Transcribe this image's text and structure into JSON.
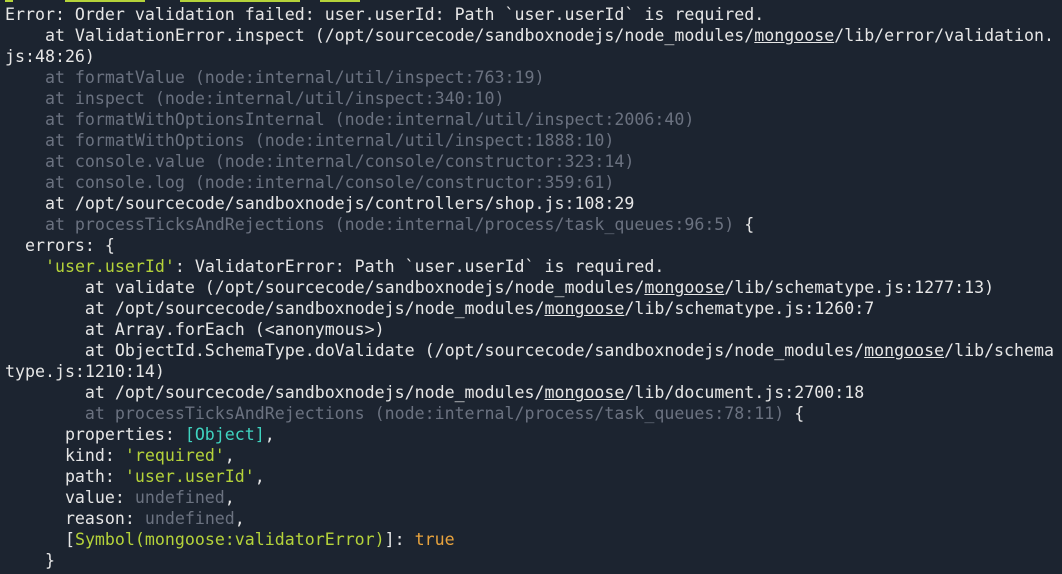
{
  "terminal": {
    "colors": {
      "background": "#1c2430",
      "text": "#e6e6e6",
      "dim": "#6b7280",
      "string": "#b5d33a",
      "special": "#3fd4c0",
      "boolean": "#e8a33d"
    },
    "error_line": "Error: Order validation failed: user.userId: Path `user.userId` is required.",
    "stack1": {
      "inspect_pre": "    at ValidationError.inspect (/opt/sourcecode/sandboxnodejs/node_modules/",
      "inspect_mod": "mongoose",
      "inspect_post": "/lib/error/validation.",
      "inspect_cont": "js:48:26)",
      "l1": "    at formatValue (node:internal/util/inspect:763:19)",
      "l2": "    at inspect (node:internal/util/inspect:340:10)",
      "l3": "    at formatWithOptionsInternal (node:internal/util/inspect:2006:40)",
      "l4": "    at formatWithOptions (node:internal/util/inspect:1888:10)",
      "l5": "    at console.value (node:internal/console/constructor:323:14)",
      "l6": "    at console.log (node:internal/console/constructor:359:61)",
      "l7": "    at /opt/sourcecode/sandboxnodejs/controllers/shop.js:108:29",
      "l8": "    at processTicksAndRejections (node:internal/process/task_queues:96:5)",
      "l8_tail": " {"
    },
    "errors_open": "  errors: {",
    "key_indent": "    ",
    "key": "'user.userId'",
    "key_rest": ": ValidatorError: Path `user.userId` is required.",
    "stack2": {
      "v_pre": "        at validate (/opt/sourcecode/sandboxnodejs/node_modules/",
      "v_mod": "mongoose",
      "v_post": "/lib/schematype.js:1277:13)",
      "a_pre": "        at /opt/sourcecode/sandboxnodejs/node_modules/",
      "a_mod": "mongoose",
      "a_post": "/lib/schematype.js:1260:7",
      "foreach": "        at Array.forEach (<anonymous>)",
      "o_pre": "        at ObjectId.SchemaType.doValidate (/opt/sourcecode/sandboxnodejs/node_modules/",
      "o_mod": "mongoose",
      "o_post": "/lib/schema",
      "o_cont": "type.js:1210:14)",
      "d_pre": "        at /opt/sourcecode/sandboxnodejs/node_modules/",
      "d_mod": "mongoose",
      "d_post": "/lib/document.js:2700:18",
      "p": "        at processTicksAndRejections (node:internal/process/task_queues:78:11)",
      "p_tail": " {"
    },
    "props": {
      "properties_key": "      properties: ",
      "properties_val": "[Object]",
      "comma": ",",
      "kind_key": "      kind: ",
      "kind_val": "'required'",
      "path_key": "      path: ",
      "path_val": "'user.userId'",
      "value_key": "      value: ",
      "value_val": "undefined",
      "reason_key": "      reason: ",
      "reason_val": "undefined",
      "sym_indent": "      ",
      "sym_open": "[",
      "sym_name": "Symbol(mongoose:validatorError)",
      "sym_close": "]: ",
      "sym_val": "true"
    },
    "close_brace": "    }"
  }
}
